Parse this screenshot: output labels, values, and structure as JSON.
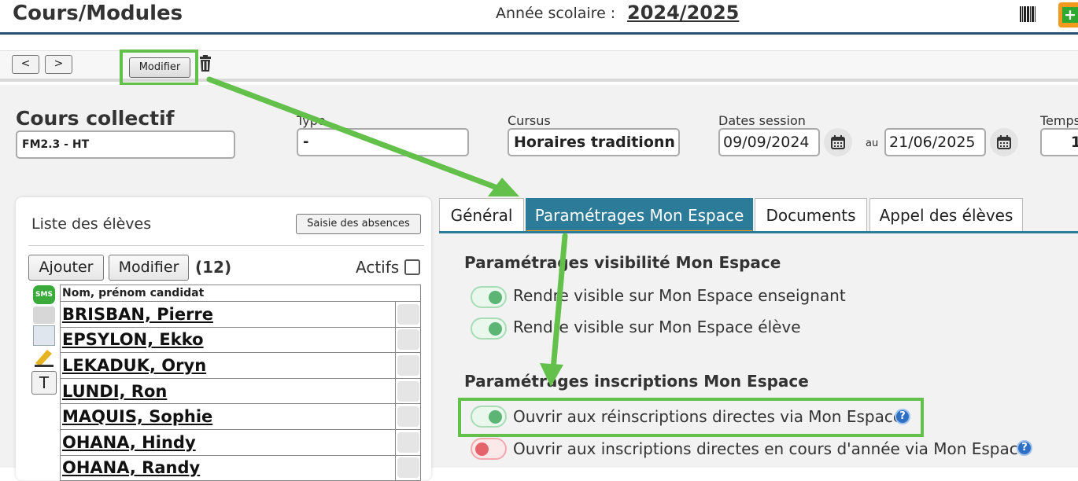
{
  "header": {
    "title": "Cours/Modules",
    "year_label": "Année scolaire :",
    "year_value": "2024/2025",
    "icons": {
      "barcode": "barcode-icon",
      "add": "plus-icon"
    },
    "colors": {
      "accent": "#2c7b98",
      "add_border": "#f39a1e",
      "add_fill": "#2fa82f"
    }
  },
  "toolbar": {
    "prev_label": "<",
    "next_label": ">",
    "modify_label": "Modifier",
    "delete_icon": "trash-icon"
  },
  "course": {
    "type": "Cours collectif",
    "code": "FM2.3 - HT",
    "type_label": "Type",
    "type_value": "-",
    "cursus_label": "Cursus",
    "cursus_value": "Horaires traditionn",
    "dates_label": "Dates session",
    "date_start": "09/09/2024",
    "date_separator": "au",
    "date_end": "21/06/2025",
    "temps_label": "Temps",
    "temps_value": "1"
  },
  "students": {
    "title": "Liste des élèves",
    "absences_button": "Saisie des absences",
    "add_button": "Ajouter",
    "modify_button": "Modifier",
    "count": "(12)",
    "actifs_label": "Actifs",
    "column_header": "Nom, prénom candidat",
    "side_icons": [
      "sms-icon",
      "mail-icon",
      "document-icon",
      "pencil-icon"
    ],
    "t_button": "T",
    "rows": [
      "BRISBAN, Pierre",
      "EPSYLON, Ekko",
      "LEKADUK, Oryn",
      "LUNDI, Ron",
      "MAQUIS, Sophie",
      "OHANA, Hindy",
      "OHANA, Randy"
    ]
  },
  "tabs": [
    {
      "label": "Général",
      "active": false
    },
    {
      "label": "Paramétrages Mon Espace",
      "active": true
    },
    {
      "label": "Documents",
      "active": false
    },
    {
      "label": "Appel des élèves",
      "active": false
    }
  ],
  "visibility": {
    "title": "Paramétrages visibilité Mon Espace",
    "options": [
      {
        "label": "Rendre visible sur Mon Espace enseignant",
        "enabled": true
      },
      {
        "label": "Rendre visible sur Mon Espace élève",
        "enabled": true
      }
    ]
  },
  "inscriptions": {
    "title": "Paramétrages inscriptions Mon Espace",
    "options": [
      {
        "label": "Ouvrir aux réinscriptions directes via Mon Espace",
        "enabled": true,
        "help": "?"
      },
      {
        "label": "Ouvrir aux inscriptions directes en cours d'année via Mon Espace",
        "enabled": false,
        "help": "?"
      }
    ]
  }
}
